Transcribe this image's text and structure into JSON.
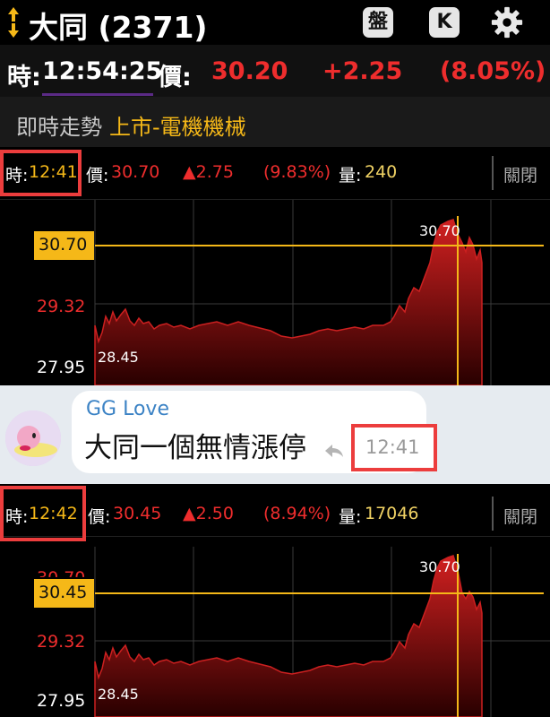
{
  "header": {
    "title": "大同 (2371)",
    "buttons": {
      "pan": "盤",
      "k": "K"
    },
    "icons": [
      "updown-arrow-icon",
      "gear-icon"
    ]
  },
  "quote": {
    "time_label": "時:",
    "time": "12:54:25",
    "price_label": "價:",
    "price": "30.20",
    "change": "+2.25",
    "percent": "(8.05%)"
  },
  "section": {
    "title": "即時走勢",
    "market": "上市-電機機械"
  },
  "rows": [
    {
      "time_label": "時:",
      "time": "12:41",
      "price_label": "價:",
      "price": "30.70",
      "change": "▲2.75",
      "percent": "(9.83%)",
      "volume_label": "量:",
      "volume": "240",
      "close": "關閉"
    },
    {
      "time_label": "時:",
      "time": "12:42",
      "price_label": "價:",
      "price": "30.45",
      "change": "▲2.50",
      "percent": "(8.94%)",
      "volume_label": "量:",
      "volume": "17046",
      "close": "關閉"
    }
  ],
  "charts": [
    {
      "y_ticks": [
        "30.70",
        "29.32",
        "27.95"
      ],
      "marker_label": "30.70",
      "low_label": "28.45",
      "high_label": "30.70"
    },
    {
      "y_ticks": [
        "30.70",
        "30.45",
        "29.32",
        "27.95"
      ],
      "marker_label": "30.45",
      "low_label": "28.45",
      "high_label": "30.70"
    }
  ],
  "chat": {
    "sender": "GG Love",
    "message": "大同一個無情漲停",
    "time": "12:41"
  },
  "colors": {
    "up_red": "#ee2d2d",
    "accent_yellow": "#f5b818",
    "price_yellow": "#f0d264",
    "sender_blue": "#3c83c5"
  }
}
